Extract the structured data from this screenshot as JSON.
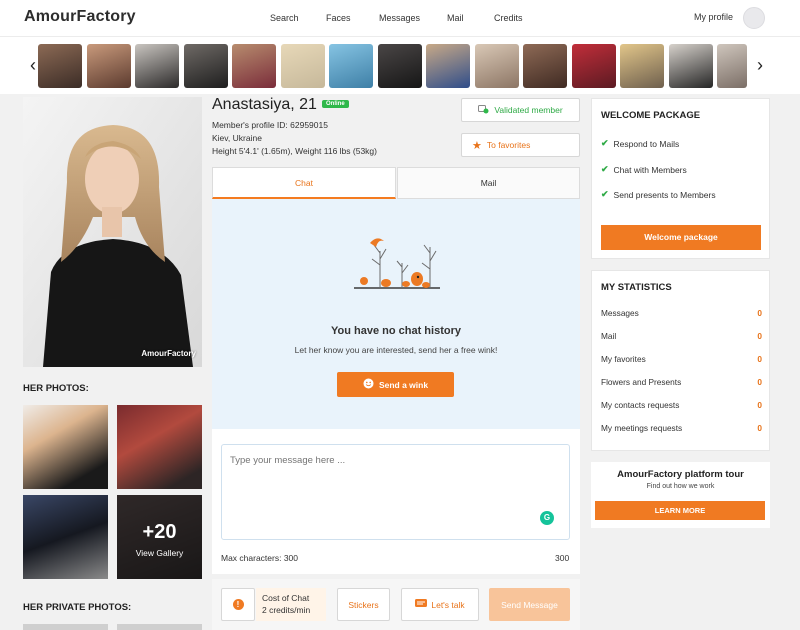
{
  "brand": {
    "logo": "AmourFactory",
    "accent": "#f07a22",
    "online_color": "#2fb84a"
  },
  "nav": {
    "items": [
      "Search",
      "Faces",
      "Messages",
      "Mail",
      "Credits"
    ],
    "profile": "My profile"
  },
  "strip": {
    "prev_icon": "‹",
    "next_icon": "›"
  },
  "profile": {
    "name": "Anastasiya, 21",
    "online": "Online",
    "profile_id": "Member's profile ID: 62959015",
    "location": "Kiev, Ukraine",
    "body": "Height 5'4.1' (1.65m), Weight 116 lbs (53kg)",
    "validated": "Validated member",
    "favorites": "To favorites",
    "watermark": "AmourFactory"
  },
  "photos": {
    "title": "HER PHOTOS:",
    "more_count": "+20",
    "view_gallery": "View Gallery",
    "private_title": "HER PRIVATE PHOTOS:"
  },
  "chat": {
    "tab_chat": "Chat",
    "tab_mail": "Mail",
    "no_history_title": "You have no chat history",
    "no_history_text": "Let her know you are interested, send her a free wink!",
    "wink_button": "Send a wink",
    "placeholder": "Type your message here ...",
    "max_chars_label": "Max characters: 300",
    "max_chars_count": "300",
    "cost_label": "Cost of Chat",
    "cost_value": "2 credits/min",
    "stickers": "Stickers",
    "lets_talk": "Let's talk",
    "send": "Send Message"
  },
  "welcome": {
    "title": "WELCOME PACKAGE",
    "items": [
      "Respond to Mails",
      "Chat with Members",
      "Send presents to Members"
    ],
    "button": "Welcome package"
  },
  "stats": {
    "title": "MY STATISTICS",
    "rows": [
      {
        "label": "Messages",
        "value": "0"
      },
      {
        "label": "Mail",
        "value": "0"
      },
      {
        "label": "My favorites",
        "value": "0"
      },
      {
        "label": "Flowers and Presents",
        "value": "0"
      },
      {
        "label": "My contacts requests",
        "value": "0"
      },
      {
        "label": "My meetings requests",
        "value": "0"
      }
    ]
  },
  "tour": {
    "title": "AmourFactory platform tour",
    "subtitle": "Find out how we work",
    "button": "LEARN MORE"
  }
}
